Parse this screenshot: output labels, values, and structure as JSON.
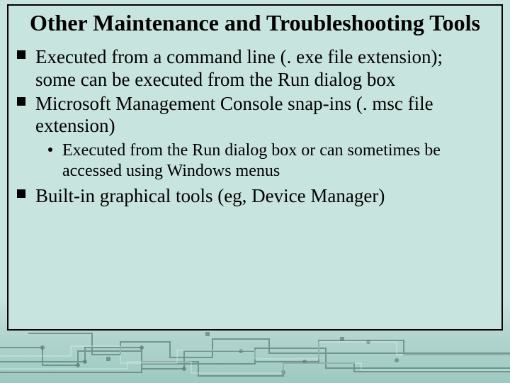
{
  "title": "Other Maintenance and Troubleshooting Tools",
  "bullets": {
    "b1": "Executed from a command line (. exe file extension); some can be executed from the Run dialog box",
    "b2": "Microsoft Management Console snap-ins (. msc file extension)",
    "b2_sub1": "Executed from the Run dialog box or can sometimes be accessed using Windows menus",
    "b3": "Built-in graphical tools (eg, Device Manager)"
  }
}
